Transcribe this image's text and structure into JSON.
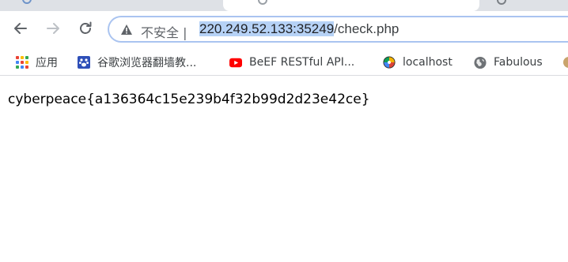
{
  "address_bar": {
    "security_label": "不安全 |",
    "url_host": "220.249.52.133:35249",
    "url_path": "/check.php"
  },
  "bookmarks": [
    {
      "label": "应用",
      "icon": "apps-grid-icon"
    },
    {
      "label": "谷歌浏览器翻墙教...",
      "icon": "paw-icon"
    },
    {
      "label": "BeEF RESTful API...",
      "icon": "youtube-icon"
    },
    {
      "label": "localhost",
      "icon": "pinwheel-icon"
    },
    {
      "label": "Fabulous",
      "icon": "globe-icon"
    }
  ],
  "page": {
    "body_text": "cyberpeace{a136364c15e239b4f32b99d2d23e42ce}"
  },
  "colors": {
    "tabstrip": "#dee1e6",
    "omnibox_border": "#aac4f0",
    "url_selection": "#b6d2f6"
  }
}
